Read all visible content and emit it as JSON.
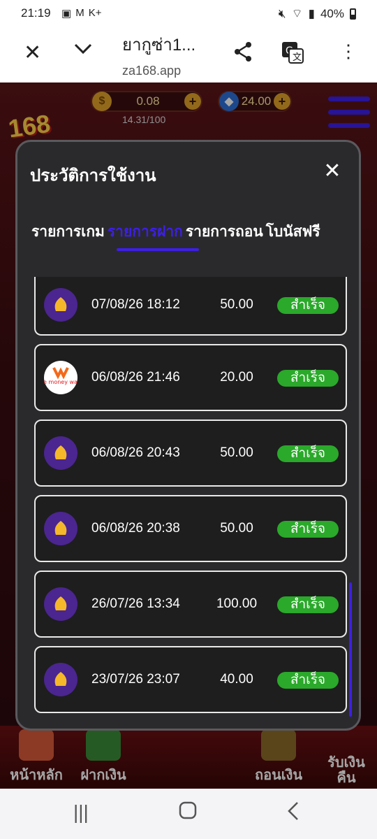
{
  "status": {
    "time": "21:19",
    "battery": "40%"
  },
  "browser": {
    "title": "ยากูซ่า1...",
    "host": "za168.app"
  },
  "hud": {
    "coin_value": "0.08",
    "gem_value": "24.00",
    "level_progress": "14.31/100"
  },
  "logo_text": "168",
  "modal": {
    "title": "ประวัติการใช้งาน",
    "tabs": [
      {
        "label": "รายการเกม"
      },
      {
        "label": "รายการฝาก"
      },
      {
        "label": "รายการถอน"
      },
      {
        "label": "โบนัสฟรี"
      }
    ],
    "active_tab": 1,
    "rows": [
      {
        "icon": "bank-icon",
        "datetime": "07/08/26 18:12",
        "amount": "50.00",
        "status": "สำเร็จ"
      },
      {
        "icon": "truemoney-icon",
        "datetime": "06/08/26 21:46",
        "amount": "20.00",
        "status": "สำเร็จ"
      },
      {
        "icon": "bank-icon",
        "datetime": "06/08/26 20:43",
        "amount": "50.00",
        "status": "สำเร็จ"
      },
      {
        "icon": "bank-icon",
        "datetime": "06/08/26 20:38",
        "amount": "50.00",
        "status": "สำเร็จ"
      },
      {
        "icon": "bank-icon",
        "datetime": "26/07/26 13:34",
        "amount": "100.00",
        "status": "สำเร็จ"
      },
      {
        "icon": "bank-icon",
        "datetime": "23/07/26 23:07",
        "amount": "40.00",
        "status": "สำเร็จ"
      }
    ]
  },
  "bottom_nav": [
    {
      "label": "หน้าหลัก"
    },
    {
      "label": "ฝากเงิน"
    },
    {
      "label": "ถอนเงิน"
    },
    {
      "label": "รับเงิน\nคืน"
    }
  ],
  "colors": {
    "accent": "#3d1fe6",
    "success": "#2aa92a",
    "bank": "#4b2590"
  },
  "truemoney_text": "true money wallet"
}
